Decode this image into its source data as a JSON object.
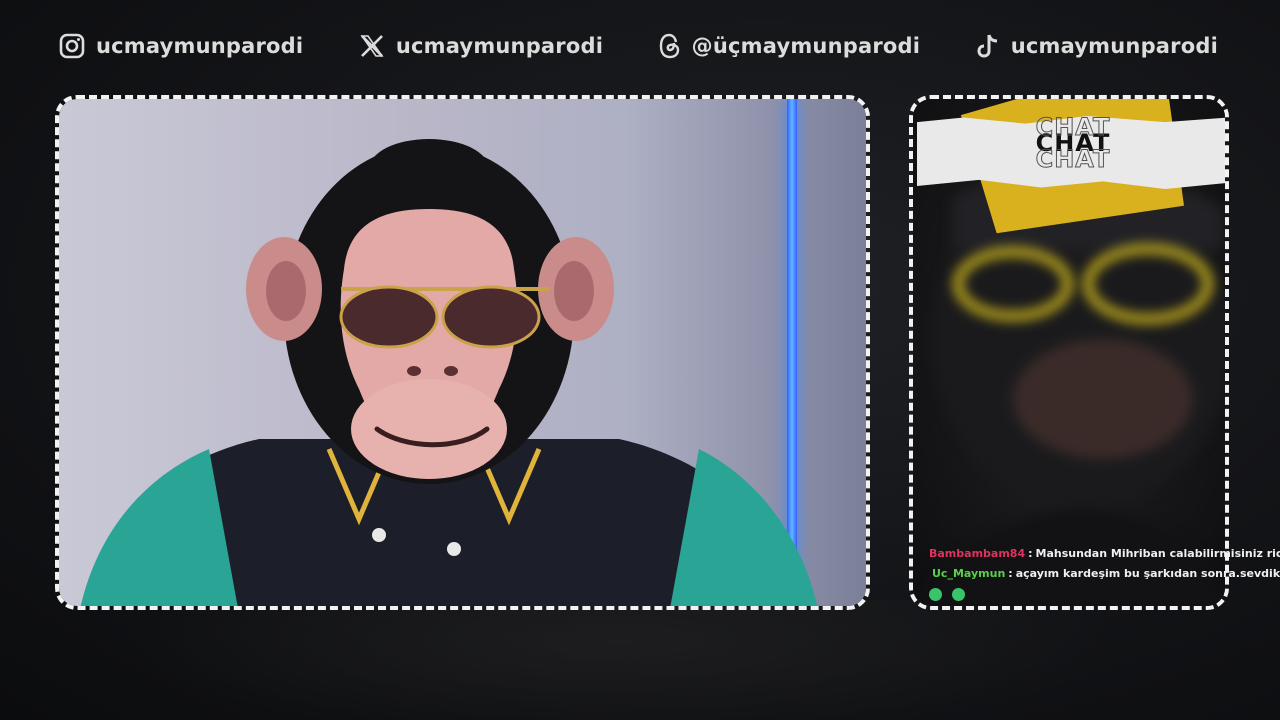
{
  "socials": [
    {
      "network": "instagram",
      "icon": "instagram-icon",
      "handle": "ucmaymunparodi"
    },
    {
      "network": "x",
      "icon": "x-icon",
      "handle": "ucmaymunparodi"
    },
    {
      "network": "threads",
      "icon": "threads-icon",
      "handle": "@üçmaymunparodi"
    },
    {
      "network": "tiktok",
      "icon": "tiktok-icon",
      "handle": "ucmaymunparodi"
    }
  ],
  "chat": {
    "title": "CHAT",
    "messages": [
      {
        "user": "Bambambam84",
        "separator": " : ",
        "text": "Mahsundan Mihriban calabilirmisiniz rica etsem",
        "user_color": "#e0325f"
      },
      {
        "user": "Uc_Maymun",
        "separator": " : ",
        "text": "açayım kardeşim bu şarkıdan sonra.sevdiklerinden",
        "user_color": "#58d14a",
        "badge": "mic-icon"
      }
    ],
    "emotes": [
      "emote-icon",
      "emote-icon"
    ]
  },
  "colors": {
    "frame": "#f2f2f2",
    "accent_yellow": "#d9b11e",
    "neon": "#3f8cff"
  }
}
